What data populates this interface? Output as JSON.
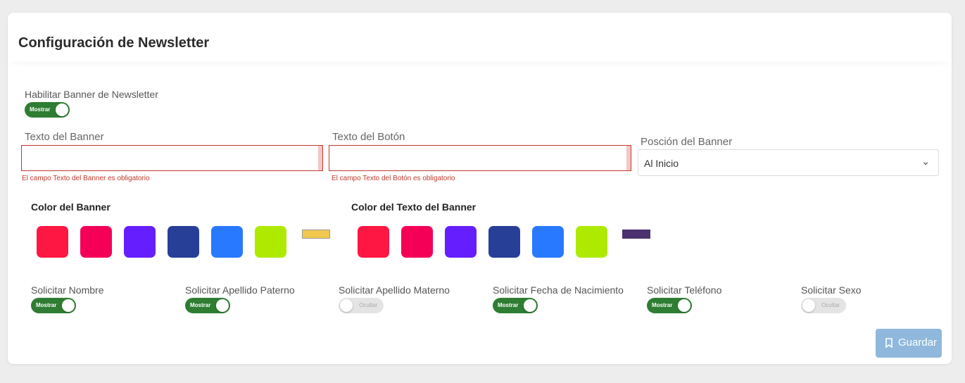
{
  "title": "Configuración de Newsletter",
  "enable_banner": {
    "label": "Habilitar Banner de Newsletter",
    "state": "Mostrar",
    "on": true
  },
  "banner_text": {
    "label": "Texto del Banner",
    "value": "",
    "error": "El campo Texto del Banner es obligatorio"
  },
  "button_text": {
    "label": "Texto del Botón",
    "value": "",
    "error": "El campo Texto del Botón es obligatorio"
  },
  "banner_position": {
    "label": "Posción del Banner",
    "value": "Al Inicio"
  },
  "banner_color": {
    "label": "Color del Banner",
    "swatches": [
      "#ff1744",
      "#f50057",
      "#651fff",
      "#283f98",
      "#2979ff",
      "#aeea00"
    ],
    "selected": "#f0c850"
  },
  "text_color": {
    "label": "Color del Texto del Banner",
    "swatches": [
      "#ff1744",
      "#f50057",
      "#651fff",
      "#283f98",
      "#2979ff",
      "#aeea00"
    ],
    "selected": "#4b3170"
  },
  "fields": [
    {
      "label": "Solicitar Nombre",
      "state": "Mostrar",
      "on": true
    },
    {
      "label": "Solicitar Apellido Paterno",
      "state": "Mostrar",
      "on": true
    },
    {
      "label": "Solicitar Apellido Materno",
      "state": "Ocultar",
      "on": false
    },
    {
      "label": "Solicitar Fecha de Nacimiento",
      "state": "Mostrar",
      "on": true
    },
    {
      "label": "Solicitar Teléfono",
      "state": "Mostrar",
      "on": true
    },
    {
      "label": "Solicitar Sexo",
      "state": "Ocultar",
      "on": false
    }
  ],
  "save_button": {
    "label": "Guardar",
    "icon": "bookmark-icon"
  }
}
